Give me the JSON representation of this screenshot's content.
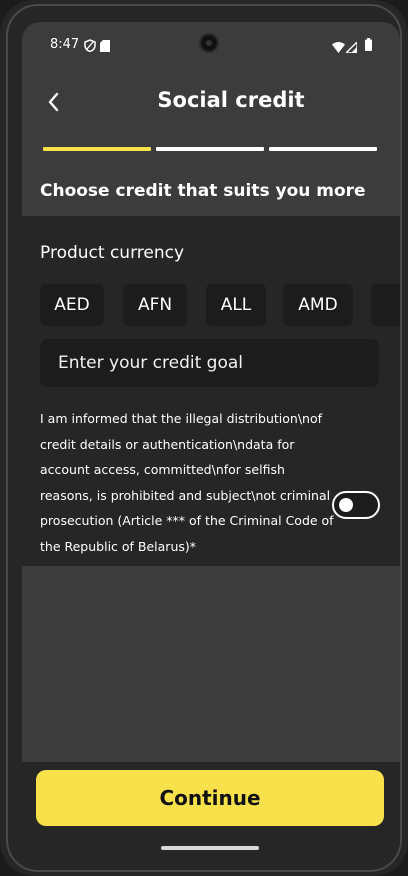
{
  "status_bar": {
    "time": "8:47",
    "icons": [
      "shield-icon",
      "sim-card-icon",
      "wifi-icon",
      "signal-icon",
      "battery-icon"
    ]
  },
  "header": {
    "back_icon": "chevron-left-icon",
    "title": "Social credit"
  },
  "progress": {
    "steps_total": 3,
    "current_step": 1,
    "active_color": "#f8e14b",
    "inactive_color": "#ffffff"
  },
  "subtitle": "Choose credit that suits you more",
  "form": {
    "currency_label": "Product currency",
    "currencies": [
      "AED",
      "AFN",
      "ALL",
      "AMD"
    ],
    "goal_placeholder": "Enter your credit goal",
    "consent_lines": [
      "I am informed that the illegal distribution\\nof",
      "credit details or authentication\\ndata for",
      "account access, committed\\nfor selfish",
      "reasons, is prohibited and subject\\not criminal",
      "prosecution (Article *** of the Criminal Code of",
      "the Republic of Belarus)*"
    ],
    "consent_toggle_on": false
  },
  "footer": {
    "continue_label": "Continue",
    "accent_color": "#f8e14b"
  }
}
